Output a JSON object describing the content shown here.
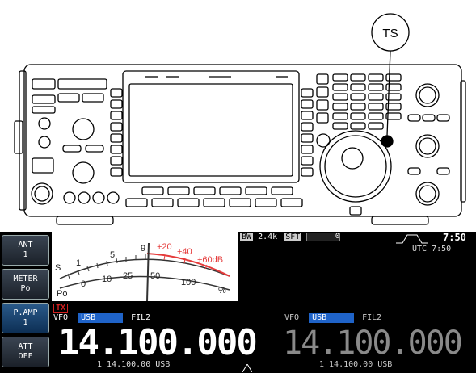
{
  "callout": {
    "label": "TS"
  },
  "softkeys": [
    {
      "top": "ANT",
      "bottom": "1"
    },
    {
      "top": "METER",
      "bottom": "Po"
    },
    {
      "top": "P.AMP",
      "bottom": "1"
    },
    {
      "top": "ATT",
      "bottom": "OFF"
    }
  ],
  "meter": {
    "s_label": "S",
    "s_scale": [
      "1",
      "5",
      "9"
    ],
    "plus_scale": [
      "+20",
      "+40",
      "+60dB"
    ],
    "po_label": "Po",
    "po_scale": [
      "0",
      "10",
      "25",
      "50",
      "100"
    ],
    "percent": "%"
  },
  "status": {
    "bw_label": "BW",
    "bw_value": "2.4k",
    "sft_label": "SFT",
    "sft_value": "0",
    "clock_big": "7:50",
    "clock_utc": "UTC  7:50"
  },
  "tx_badge": "TX",
  "main_vfo": {
    "vfo": "VFO",
    "mode": "USB",
    "filter": "FIL2",
    "frequency": "14.100.000",
    "sub_line": "1  14.100.00 USB"
  },
  "sub_vfo": {
    "vfo": "VFO",
    "mode": "USB",
    "filter": "FIL2",
    "frequency": "14.100.000",
    "sub_line": "1  14.100.00 USB"
  },
  "colors": {
    "mode_badge": "#1f63c8",
    "tx_badge": "#d32020",
    "meter_red": "#e53b3b",
    "lcd_bg": "#000000",
    "softkey": "#2b3440"
  }
}
